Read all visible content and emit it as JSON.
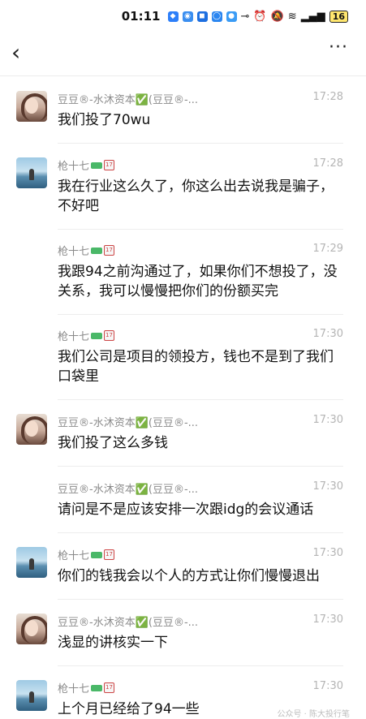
{
  "status_bar": {
    "time": "01:11",
    "battery": "16"
  },
  "header": {
    "back_icon": "chevron-left-icon",
    "more_label": "···"
  },
  "messages": [
    {
      "sender": "豆豆®-水沐资本✅(豆豆®-...",
      "time": "17:28",
      "text": "我们投了70wu",
      "avatar": "woman-portrait"
    },
    {
      "sender": "枪十七",
      "time": "17:28",
      "text": "我在行业这么久了，你这么出去说我是骗子，不好吧",
      "avatar": "seaside-portrait"
    },
    {
      "sender": "枪十七",
      "time": "17:29",
      "text": "我跟94之前沟通过了，如果你们不想投了，没关系，我可以慢慢把你们的份额买完",
      "avatar": "none"
    },
    {
      "sender": "枪十七",
      "time": "17:30",
      "text": "我们公司是项目的领投方，钱也不是到了我们口袋里",
      "avatar": "none"
    },
    {
      "sender": "豆豆®-水沐资本✅(豆豆®-...",
      "time": "17:30",
      "text": "我们投了这么多钱",
      "avatar": "woman-portrait"
    },
    {
      "sender": "豆豆®-水沐资本✅(豆豆®-...",
      "time": "17:30",
      "text": "请问是不是应该安排一次跟idg的会议通话",
      "avatar": "none"
    },
    {
      "sender": "枪十七",
      "time": "17:30",
      "text": "你们的钱我会以个人的方式让你们慢慢退出",
      "avatar": "seaside-portrait"
    },
    {
      "sender": "豆豆®-水沐资本✅(豆豆®-...",
      "time": "17:30",
      "text": "浅显的讲核实一下",
      "avatar": "woman-portrait"
    },
    {
      "sender": "枪十七",
      "time": "17:30",
      "text": "上个月已经给了94一些",
      "avatar": "seaside-portrait"
    }
  ],
  "watermark": "公众号 · 陈大投行笔"
}
